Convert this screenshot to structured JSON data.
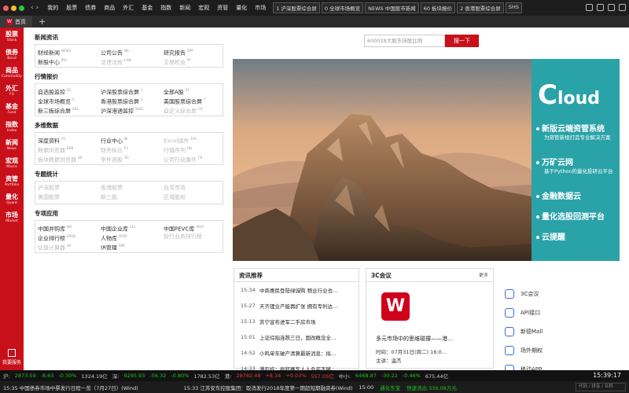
{
  "menu": [
    "我的",
    "股票",
    "债券",
    "商品",
    "外汇",
    "基金",
    "指数",
    "新闻",
    "宏观",
    "资管",
    "量化",
    "市场"
  ],
  "ticker_tabs": [
    "1 沪深股票综合屏",
    "0 全球市场概览",
    "NEWS 中国股市新闻",
    "60 板块报价",
    "2 香港股票综合屏",
    "SHS"
  ],
  "tab": {
    "label": "首页",
    "logo": "W",
    "add": "+"
  },
  "sidebar": [
    {
      "cn": "股票",
      "en": "Stock"
    },
    {
      "cn": "债券",
      "en": "Bond"
    },
    {
      "cn": "商品",
      "en": "Commodity"
    },
    {
      "cn": "外汇",
      "en": "FX"
    },
    {
      "cn": "基金",
      "en": "Fund"
    },
    {
      "cn": "指数",
      "en": "Index"
    },
    {
      "cn": "新闻",
      "en": "News"
    },
    {
      "cn": "宏观",
      "en": "Macro"
    },
    {
      "cn": "资管",
      "en": "Portfolio"
    },
    {
      "cn": "量化",
      "en": "Quant"
    },
    {
      "cn": "市场",
      "en": "Market"
    }
  ],
  "service_label": "我要服务",
  "sections": [
    {
      "title": "新闻资讯",
      "rows": [
        [
          {
            "t": "财经新闻",
            "s": "NEWS"
          },
          {
            "t": "公司公告",
            "s": "NA"
          },
          {
            "t": "研究报告",
            "s": "RPP"
          }
        ],
        [
          {
            "t": "新股中心",
            "s": "IPO"
          },
          {
            "t": "法律法规",
            "s": "LAW",
            "dim": true
          },
          {
            "t": "交易机会",
            "s": "PT",
            "dim": true
          }
        ]
      ]
    },
    {
      "title": "行情报价",
      "rows": [
        [
          {
            "t": "自选股监控",
            "s": "SS"
          },
          {
            "t": "沪深股票综合屏",
            "s": "1"
          },
          {
            "t": "全部A股",
            "s": "92"
          }
        ],
        [
          {
            "t": "全球市场概览",
            "s": "0"
          },
          {
            "t": "香港股票综合屏",
            "s": "2"
          },
          {
            "t": "美国股票综合屏",
            "s": "7"
          }
        ],
        [
          {
            "t": "新三板综合屏",
            "s": "ASS"
          },
          {
            "t": "沪深港通监控",
            "s": "SHSC"
          },
          {
            "t": "自定义综合屏",
            "s": "CS",
            "dim": true
          }
        ]
      ]
    },
    {
      "title": "多维数据",
      "rows": [
        [
          {
            "t": "深度资料",
            "s": "F9"
          },
          {
            "t": "行业中心",
            "s": "IN"
          },
          {
            "t": "Excel插件",
            "s": "EXL",
            "dim": true
          }
        ],
        [
          {
            "t": "数据浏览器",
            "s": "EDB",
            "dim": true
          },
          {
            "t": "财务纵比",
            "s": "FS",
            "dim": true
          },
          {
            "t": "行情序列",
            "s": "HQ",
            "dim": true
          }
        ],
        [
          {
            "t": "板块数据浏览器",
            "s": "SD",
            "dim": true
          },
          {
            "t": "条件选股",
            "s": "XG",
            "dim": true
          },
          {
            "t": "公司行动事件",
            "s": "CE",
            "dim": true
          }
        ]
      ]
    },
    {
      "title": "专题统计",
      "rows": [
        [
          {
            "t": "沪深股票",
            "s": "",
            "dim": true
          },
          {
            "t": "香港股票",
            "s": "",
            "dim": true
          },
          {
            "t": "台湾市场",
            "s": "",
            "dim": true
          }
        ],
        [
          {
            "t": "美国股票",
            "s": "",
            "dim": true
          },
          {
            "t": "新三板",
            "s": "",
            "dim": true
          },
          {
            "t": "区域股权",
            "s": "",
            "dim": true
          }
        ]
      ]
    },
    {
      "title": "专项应用",
      "rows": [
        [
          {
            "t": "中国并购库",
            "s": "MA"
          },
          {
            "t": "中国企业库",
            "s": "CEL"
          },
          {
            "t": "中国PEVC库",
            "s": "PEVC"
          }
        ],
        [
          {
            "t": "企业排行榜",
            "s": "ERGB"
          },
          {
            "t": "人物库",
            "s": "PEOP"
          },
          {
            "t": "投行业务排行榜",
            "s": "",
            "dim": true
          }
        ],
        [
          {
            "t": "估值计算器",
            "s": "VA",
            "dim": true
          },
          {
            "t": "IR管理",
            "s": "WIR"
          },
          {
            "t": "",
            "s": ""
          }
        ]
      ]
    }
  ],
  "search": {
    "placeholder": "600028大股东持股比例",
    "button": "搜一下"
  },
  "cloud": {
    "title_c": "C",
    "title_rest": "loud",
    "features": [
      {
        "title": "新版云端资管系统",
        "sub": "为资管新规打造专业解决方案"
      },
      {
        "title": "万矿云网",
        "sub": "基于Python的量化投研云平台"
      },
      {
        "title": "金融数据云",
        "sub": ""
      },
      {
        "title": "量化选股回测平台",
        "sub": ""
      },
      {
        "title": "云提醒",
        "sub": ""
      }
    ]
  },
  "news": {
    "title": "资讯推荐",
    "items": [
      {
        "time": "15:34",
        "head": "中商惠民登陆绿诚购 物业行业也…"
      },
      {
        "time": "15:27",
        "head": "天齐锂业产能再扩张 拥有专利达…"
      },
      {
        "time": "15:13",
        "head": "苏宁宣布进军二手房市场"
      },
      {
        "time": "15:01",
        "head": "上证综指连跌三日，国改概念全…"
      },
      {
        "time": "14:52",
        "head": "小鸣单车破产清算最新消息：拟…"
      },
      {
        "time": "14:33",
        "head": "潘石屹：疯狂赛车人人会买不够…"
      }
    ]
  },
  "meeting": {
    "title": "3C会议",
    "more": "更多",
    "logo": "W",
    "name": "多元市场中的思维碰撞——港…",
    "time": "时间：07月31日(周二) 16:0…",
    "speaker": "主讲：温杰"
  },
  "quick": [
    "3C会议",
    "API接口",
    "新德Mall",
    "场外期权",
    "移动APP"
  ],
  "status1": {
    "sh_label": "沪:",
    "sh": [
      "2873.59",
      "-8.63",
      "-0.30%",
      "1324.19亿"
    ],
    "sz_label": "深:",
    "sz": [
      "9295.93",
      "-56.32",
      "-0.80%",
      "1782.53亿"
    ],
    "hk_label": "港:",
    "hk": [
      "28782.48",
      "+8.34",
      "+0.03%",
      "557.05亿"
    ],
    "zx_label": "中小:",
    "zx": [
      "6468.87",
      "-30.22",
      "-0.46%",
      "675.44亿"
    ],
    "time": "15:39:17"
  },
  "status2": {
    "left": "15:35 中国债券市场中票发行日程一览（7月27日）(Wind)",
    "mid": "15:33 江苏安东控股集团：取消发行2018年度第一期超短期融资券(Wind)",
    "right1": "15:00",
    "right2": "通化东宝",
    "right3": "快速流出 336.08万元",
    "code_placeholder": "代码 / 拼音 / 名称"
  },
  "colors": {
    "brand_red": "#c8101a",
    "cloud_teal": "#2aa3a8",
    "up": "#e23b3b",
    "down": "#20c020"
  }
}
